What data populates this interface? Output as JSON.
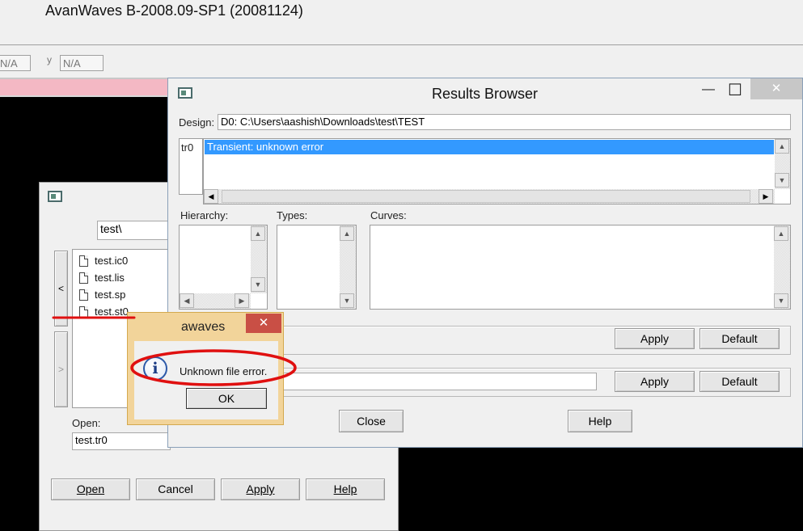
{
  "app": {
    "title": "AvanWaves B-2008.09-SP1 (20081124)",
    "coord_x": "N/A",
    "coord_y_label": "y",
    "coord_y": "N/A"
  },
  "results_browser": {
    "title": "Results Browser",
    "design_label": "Design:",
    "design_value": "D0: C:\\Users\\aashish\\Downloads\\test\\TEST",
    "analysis_tag": "tr0",
    "analysis_items": [
      "Transient: unknown error"
    ],
    "hierarchy_label": "Hierarchy:",
    "types_label": "Types:",
    "curves_label": "Curves:",
    "apply_label": "Apply",
    "default_label": "Default",
    "close_label": "Close",
    "help_label": "Help"
  },
  "open_dialog": {
    "filter_value": "test\\",
    "files": [
      "test.ic0",
      "test.lis",
      "test.sp",
      "test.st0"
    ],
    "nav_up": "<",
    "nav_down": ">",
    "open_label": "Open:",
    "open_value": "test.tr0",
    "buttons": {
      "open": "Open",
      "cancel": "Cancel",
      "apply": "Apply",
      "help": "Help"
    }
  },
  "alert": {
    "title": "awaves",
    "message": "Unknown file error.",
    "ok_label": "OK",
    "close_glyph": "✕",
    "icon_glyph": "i"
  },
  "window_controls": {
    "minimize": "—",
    "maximize": "☐",
    "close": "✕"
  },
  "colors": {
    "selection": "#3399ff",
    "pink_strip": "#f4b8c4",
    "alert_frame": "#f2d49a",
    "close_red": "#c94f45",
    "annotation_red": "#e01010"
  }
}
